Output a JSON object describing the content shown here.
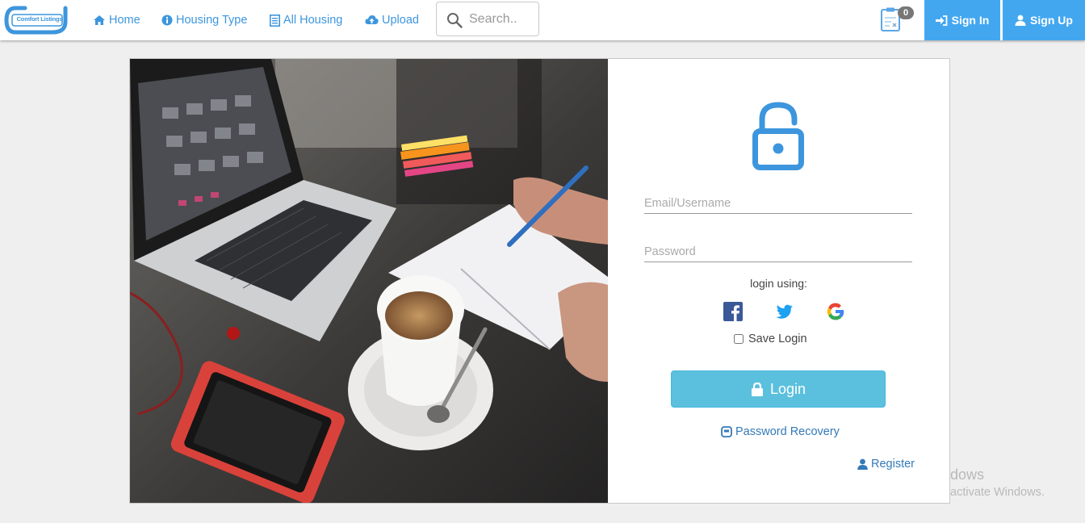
{
  "brand": {
    "logo_text": "Comfort Listings"
  },
  "nav": {
    "home": "Home",
    "housing_type": "Housing Type",
    "all_housing": "All Housing",
    "upload": "Upload"
  },
  "search": {
    "placeholder": "Search.."
  },
  "cart": {
    "count": "0"
  },
  "auth": {
    "sign_in": "Sign In",
    "sign_up": "Sign Up"
  },
  "login": {
    "email_placeholder": "Email/Username",
    "password_placeholder": "Password",
    "login_using": "login using:",
    "save_login": "Save Login",
    "save_login_checked": false,
    "login_button": "Login",
    "password_recovery": "Password Recovery",
    "register": "Register"
  },
  "watermark": {
    "line1": "dows",
    "line2": "activate Windows."
  },
  "colors": {
    "accent": "#43a7f0",
    "link": "#337ab7",
    "login_button": "#5bc0de",
    "facebook": "#3b5998",
    "twitter": "#1da1f2"
  },
  "icons": {
    "home": "home-icon",
    "housing_type": "info-circle-icon",
    "all_housing": "list-icon",
    "upload": "cloud-upload-icon",
    "search": "search-icon",
    "cart": "clipboard-icon",
    "sign_in": "sign-in-icon",
    "sign_up": "user-icon",
    "lock": "unlock-icon",
    "facebook": "facebook-icon",
    "twitter": "twitter-icon",
    "google": "google-icon",
    "login": "lock-icon",
    "password_recovery": "recovery-icon",
    "register": "user-icon"
  }
}
